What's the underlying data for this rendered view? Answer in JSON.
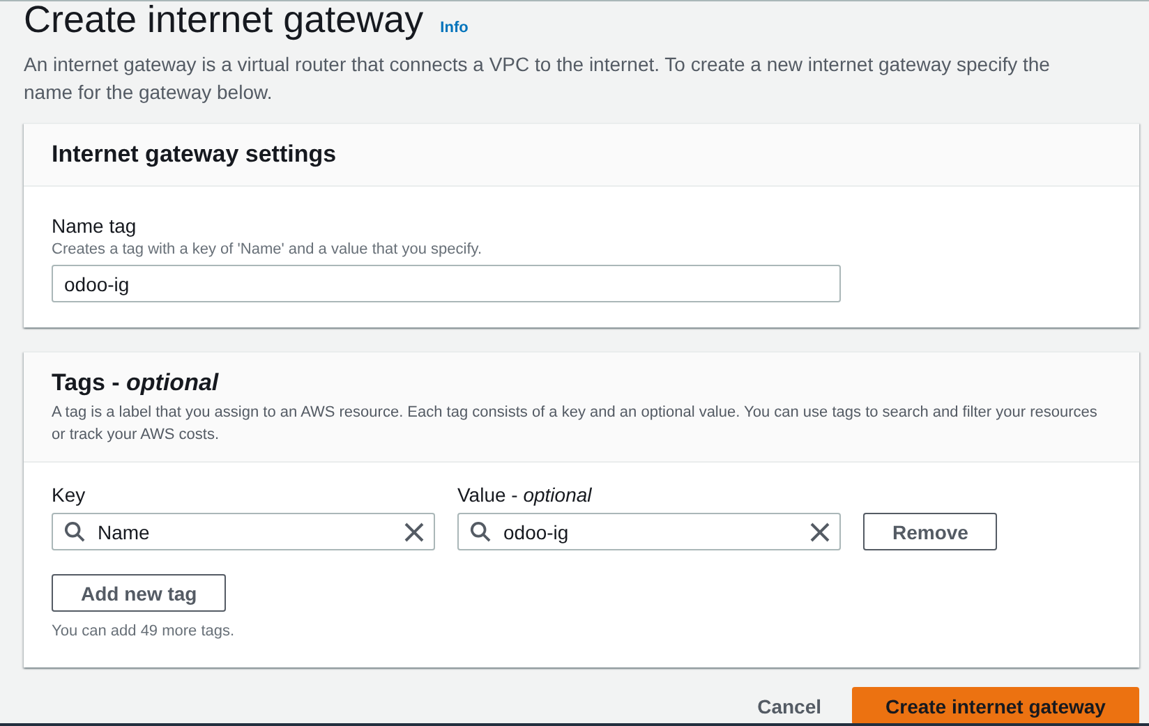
{
  "header": {
    "title": "Create internet gateway",
    "info_link": "Info",
    "description": "An internet gateway is a virtual router that connects a VPC to the internet. To create a new internet gateway specify the name for the gateway below."
  },
  "settings_panel": {
    "title": "Internet gateway settings",
    "name_tag": {
      "label": "Name tag",
      "hint": "Creates a tag with a key of 'Name' and a value that you specify.",
      "value": "odoo-ig"
    }
  },
  "tags_panel": {
    "title": "Tags - *optional*",
    "description": "A tag is a label that you assign to an AWS resource. Each tag consists of a key and an optional value. You can use tags to search and filter your resources or track your AWS costs.",
    "key_label": "Key",
    "value_label": "Value - *optional*",
    "tags": [
      {
        "key": "Name",
        "value": "odoo-ig",
        "remove_button": "Remove"
      }
    ],
    "add_button": "Add new tag",
    "limit_hint": "You can add 49 more tags."
  },
  "footer": {
    "cancel": "Cancel",
    "submit": "Create internet gateway"
  }
}
